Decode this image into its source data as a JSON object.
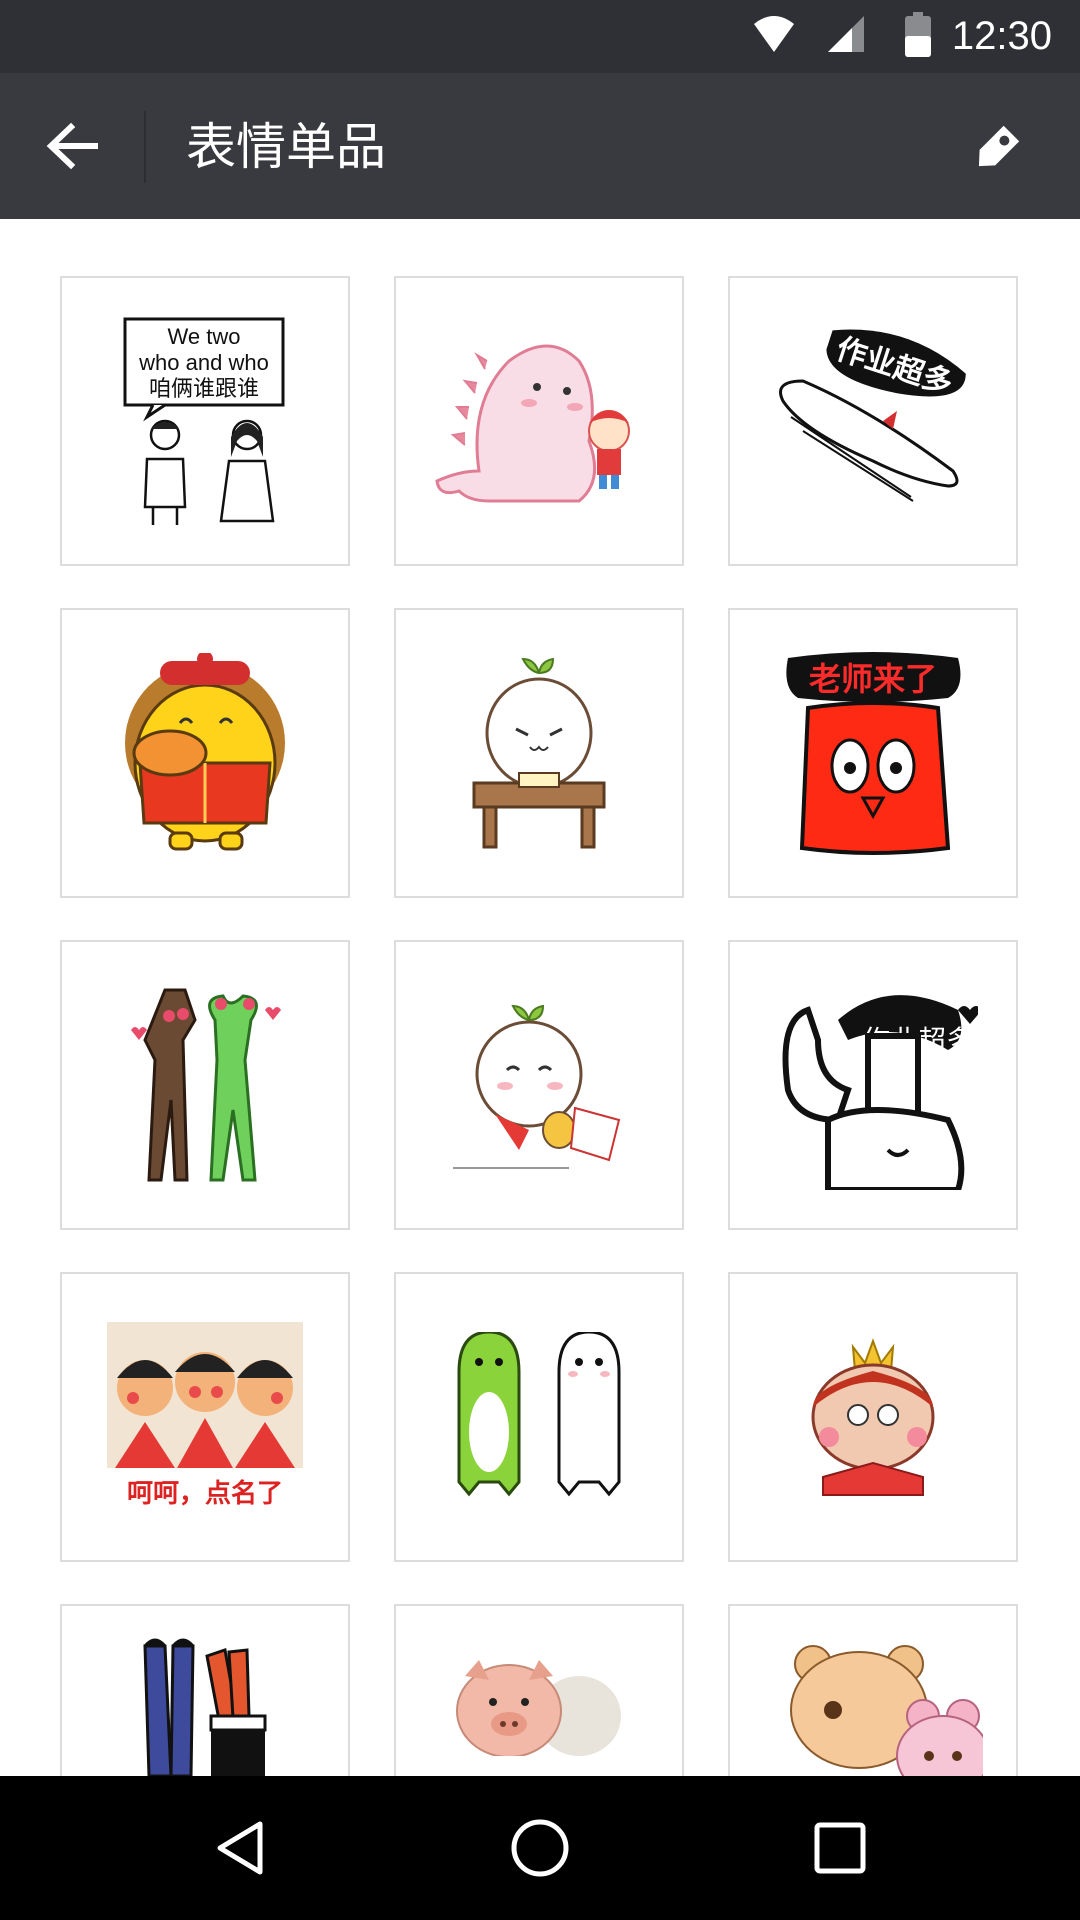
{
  "status_bar": {
    "time": "12:30",
    "icons": [
      "wifi-icon",
      "cell-signal-icon",
      "battery-icon"
    ]
  },
  "app_bar": {
    "title": "表情单品",
    "back_icon": "arrow-left-icon",
    "tag_icon": "tag-icon"
  },
  "stickers": {
    "s1": {
      "line1": "We two",
      "line2": "who and who",
      "line3": "咱俩谁跟谁"
    },
    "s3": {
      "text": "作业超多"
    },
    "s6": {
      "text": "老师来了"
    },
    "s9": {
      "text": "作业超多"
    },
    "s10": {
      "text": "呵呵，点名了"
    }
  },
  "nav_bar": {
    "icons": [
      "back-triangle-icon",
      "home-circle-icon",
      "recents-square-icon"
    ]
  },
  "colors": {
    "status_bg": "#2f3035",
    "app_bar_bg": "#393a3f",
    "nav_bg": "#000000",
    "cell_border": "#dcdcdc"
  }
}
